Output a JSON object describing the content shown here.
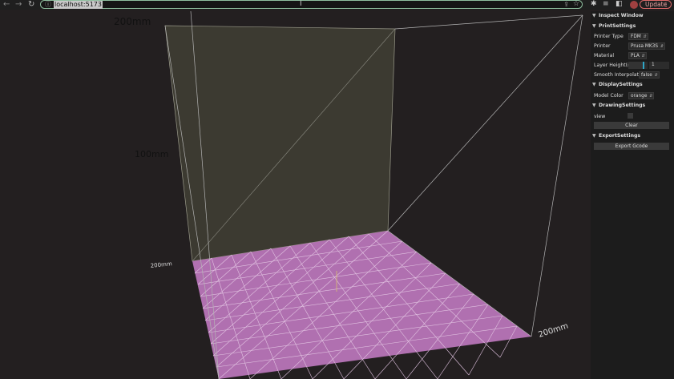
{
  "browser": {
    "url": "localhost:5173",
    "update_label": "Update"
  },
  "scene_labels": {
    "top_height": "200mm",
    "mid_height": "100mm",
    "left_depth": "200mm",
    "right_width": "200mm"
  },
  "colors": {
    "background": "#231f20",
    "back_wall": "#3c3a31",
    "floor": "#b070b0",
    "panel": "#1c1c1c",
    "accent": "#2ea6c7"
  },
  "panel": {
    "inspect_title": "Inspect Window",
    "print_settings": {
      "title": "PrintSettings",
      "printer_type_label": "Printer Type",
      "printer_type_value": "FDM",
      "printer_label": "Printer",
      "printer_value": "Prusa MK3S",
      "material_label": "Material",
      "material_value": "PLA",
      "layer_height_label": "Layer Height(mm)",
      "layer_height_value": "1",
      "smooth_label": "Smooth Interpolation",
      "smooth_value": "false"
    },
    "display_settings": {
      "title": "DisplaySettings",
      "model_color_label": "Model Color",
      "model_color_value": "orange"
    },
    "drawing_settings": {
      "title": "DrawingSettings",
      "view_label": "view",
      "clear_label": "Clear"
    },
    "export_settings": {
      "title": "ExportSettings",
      "export_label": "Export Gcode"
    }
  }
}
